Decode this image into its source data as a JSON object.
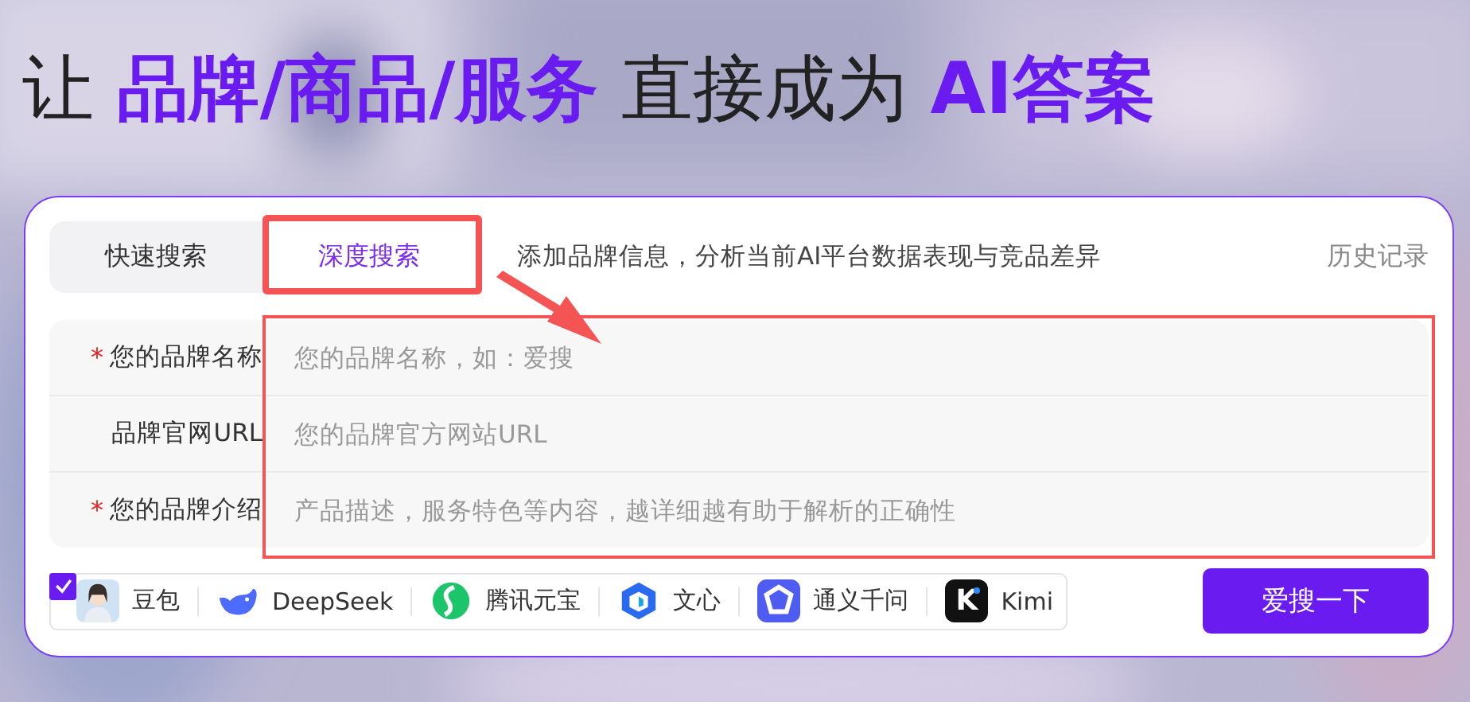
{
  "headline": "让 **品牌/商品/服务** 直接成为 **AI答案**",
  "tabs": [
    {
      "label": "快速搜索",
      "selected": false
    },
    {
      "label": "深度搜索",
      "selected": true
    }
  ],
  "description": "添加品牌信息，分析当前AI平台数据表现与竞品差异",
  "history_link": "历史记录",
  "form": [
    {
      "marker": "*",
      "label": "您的品牌名称",
      "placeholder": "您的品牌名称，如：爱搜"
    },
    {
      "label": "品牌官网URL",
      "placeholder": "您的品牌官方网站URL"
    },
    {
      "marker": "*",
      "label": "您的品牌介绍",
      "placeholder": "产品描述，服务特色等内容，越详细越有助于解析的正确性"
    }
  ],
  "platforms": {
    "checked": true,
    "items": [
      {
        "kind": "avatar",
        "name": "豆包"
      },
      {
        "kind": "whale",
        "name": "DeepSeek"
      },
      {
        "kind": "swirl",
        "name": "腾讯元宝"
      },
      {
        "kind": "cube",
        "name": "文心"
      },
      {
        "kind": "spark",
        "name": "通义千问"
      },
      {
        "kind": "letter",
        "icon_text": "K",
        "name": "Kimi"
      }
    ]
  },
  "submit_button": "爱搜一下"
}
